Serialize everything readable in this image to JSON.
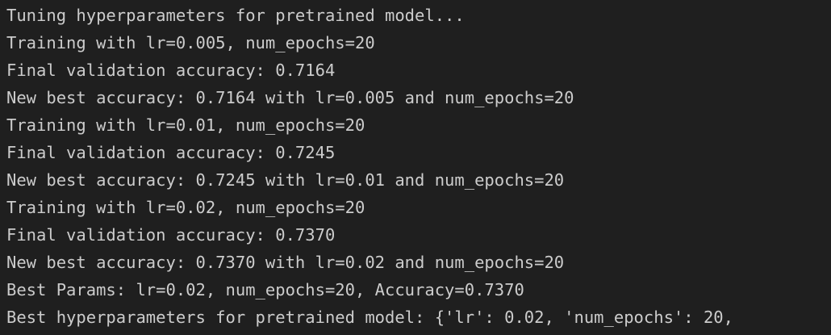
{
  "output": {
    "lines": [
      "Tuning hyperparameters for pretrained model...",
      "Training with lr=0.005, num_epochs=20",
      "Final validation accuracy: 0.7164",
      "New best accuracy: 0.7164 with lr=0.005 and num_epochs=20",
      "Training with lr=0.01, num_epochs=20",
      "Final validation accuracy: 0.7245",
      "New best accuracy: 0.7245 with lr=0.01 and num_epochs=20",
      "Training with lr=0.02, num_epochs=20",
      "Final validation accuracy: 0.7370",
      "New best accuracy: 0.7370 with lr=0.02 and num_epochs=20",
      "Best Params: lr=0.02, num_epochs=20, Accuracy=0.7370",
      "Best hyperparameters for pretrained model: {'lr': 0.02, 'num_epochs': 20,"
    ]
  },
  "colors": {
    "background": "#1f1f1f",
    "text": "#cccccc"
  }
}
